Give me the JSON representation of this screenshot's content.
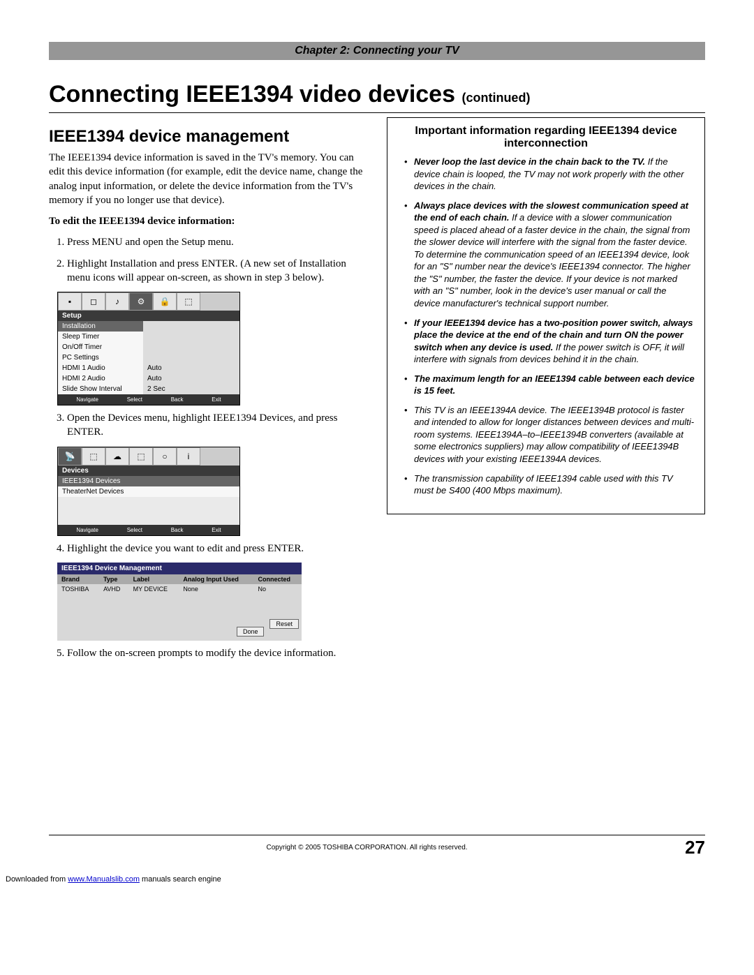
{
  "chapter": "Chapter 2: Connecting your TV",
  "title_main": "Connecting IEEE1394 video devices ",
  "title_cont": "(continued)",
  "sub_heading": "IEEE1394 device management",
  "intro": "The IEEE1394 device information is saved in the TV's memory. You can edit this device information (for example, edit the device name, change the analog input information, or delete the device information from the TV's memory if you no longer use that device).",
  "edit_label": "To edit the IEEE1394 device information:",
  "steps": {
    "s1": "Press MENU and open the Setup menu.",
    "s2": "Highlight Installation and press ENTER. (A new set of Installation menu icons will appear on-screen, as shown in step 3 below).",
    "s3": "Open the Devices menu, highlight IEEE1394 Devices, and press ENTER.",
    "s4": "Highlight the device you want to edit and press ENTER.",
    "s5": "Follow the on-screen prompts to modify the device information."
  },
  "menu1": {
    "title": "Setup",
    "rows": [
      {
        "k": "Installation",
        "v": "",
        "hl": true
      },
      {
        "k": "Sleep Timer",
        "v": ""
      },
      {
        "k": "On/Off Timer",
        "v": ""
      },
      {
        "k": "PC Settings",
        "v": ""
      },
      {
        "k": "HDMI 1 Audio",
        "v": "Auto"
      },
      {
        "k": "HDMI 2 Audio",
        "v": "Auto"
      },
      {
        "k": "Slide Show Interval",
        "v": "2 Sec"
      }
    ],
    "footer": [
      "Navigate",
      "Select",
      "Back",
      "Exit"
    ]
  },
  "menu2": {
    "title": "Devices",
    "rows": [
      {
        "k": "IEEE1394 Devices",
        "v": "",
        "hl": true
      },
      {
        "k": "TheaterNet Devices",
        "v": ""
      }
    ],
    "footer": [
      "Navigate",
      "Select",
      "Back",
      "Exit"
    ]
  },
  "devmgmt": {
    "title": "IEEE1394 Device Management",
    "headers": [
      "Brand",
      "Type",
      "Label",
      "Analog Input Used",
      "Connected"
    ],
    "row": [
      "TOSHIBA",
      "AVHD",
      "MY DEVICE",
      "None",
      "No"
    ],
    "buttons": [
      "Reset",
      "Done"
    ]
  },
  "callout": {
    "heading": "Important information regarding IEEE1394 device interconnection",
    "b1_bi": "Never loop the last device in the chain back to the TV.",
    "b1_it": " If the device chain is looped, the TV may not work properly with the other devices in the chain.",
    "b2_bi": "Always place devices with the slowest communication speed at the end of each chain.",
    "b2_it": " If a device with a slower communication speed is placed ahead of a faster device in the chain, the signal from the slower device will interfere with the signal from the faster device. To determine the communication speed of an IEEE1394 device, look for an \"S\" number near the device's IEEE1394 connector. The higher the \"S\" number, the faster the device. If your device is not marked with an \"S\" number, look in the device's user manual or call the device manufacturer's technical support number.",
    "b3_bi": "If your IEEE1394 device has a two-position power switch, always place the device at the end of the chain and turn ON the power switch when any device is used.",
    "b3_it": " If the power switch is OFF, it will interfere with signals from devices behind it in the chain.",
    "b4_bi": "The maximum length for an IEEE1394 cable between each device is 15 feet.",
    "b5_it": "This TV is an IEEE1394A device. The IEEE1394B protocol is faster and intended to allow for longer distances between devices and multi-room systems. IEEE1394A–to–IEEE1394B converters (available at some electronics suppliers) may allow compatibility of IEEE1394B devices with your existing IEEE1394A devices.",
    "b6_it": "The transmission capability of IEEE1394 cable used with this TV must be S400 (400 Mbps maximum)."
  },
  "copyright": "Copyright © 2005 TOSHIBA CORPORATION. All rights reserved.",
  "page_num": "27",
  "dl_pre": "Downloaded from ",
  "dl_link": "www.Manualslib.com",
  "dl_post": " manuals search engine"
}
